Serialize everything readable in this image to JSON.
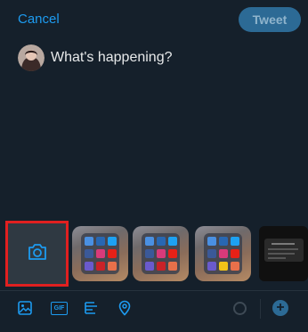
{
  "header": {
    "cancel_label": "Cancel",
    "tweet_label": "Tweet"
  },
  "compose": {
    "prompt": "What's happening?"
  },
  "toolbar": {
    "gif_label": "GIF"
  },
  "colors": {
    "accent": "#1d9bf0",
    "background": "#15202b",
    "tweet_button_disabled": "#2c6a95",
    "highlight_border": "#e02020"
  }
}
